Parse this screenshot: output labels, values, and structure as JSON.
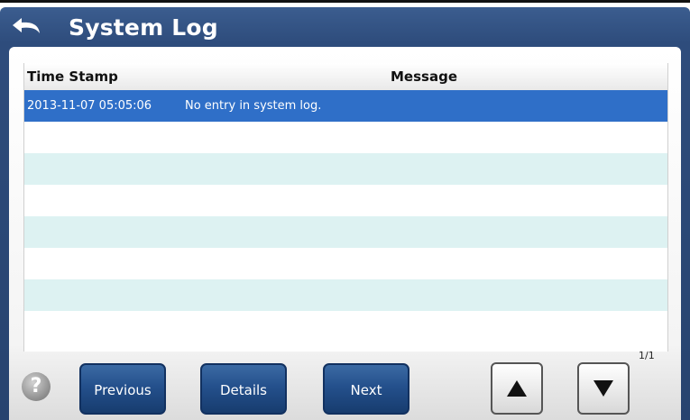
{
  "window": {
    "title": "System Log"
  },
  "table": {
    "headers": {
      "time": "Time Stamp",
      "message": "Message"
    },
    "rows": [
      {
        "time": "2013-11-07 05:05:06",
        "message": "No entry in system log."
      }
    ]
  },
  "pagination": {
    "indicator": "1/1"
  },
  "buttons": {
    "previous": "Previous",
    "details": "Details",
    "next": "Next",
    "help": "?"
  },
  "icons": {
    "back": "back-arrow-icon",
    "help": "question-mark-icon",
    "up": "triangle-up-icon",
    "down": "triangle-down-icon"
  },
  "colors": {
    "header_bg": "#2e4c7c",
    "selected_row": "#2f6fc8",
    "alt_row": "#ddf2f2",
    "button_bg": "#24508c"
  }
}
